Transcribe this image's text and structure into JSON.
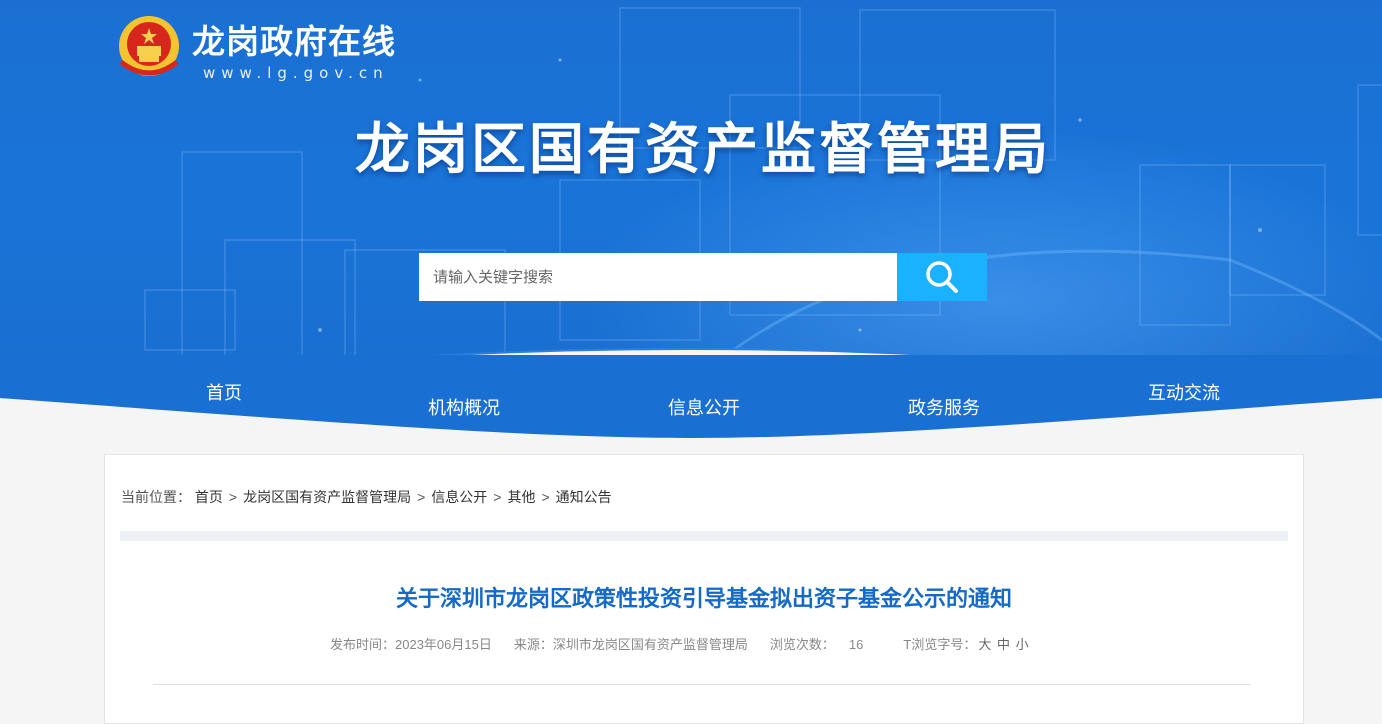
{
  "header": {
    "logo_title": "龙岗政府在线",
    "logo_url": "www.lg.gov.cn",
    "site_title": "龙岗区国有资产监督管理局",
    "search_placeholder": "请输入关键字搜索"
  },
  "nav": [
    "首页",
    "机构概况",
    "信息公开",
    "政务服务",
    "互动交流"
  ],
  "breadcrumb": {
    "label": "当前位置：",
    "items": [
      "首页",
      "龙岗区国有资产监督管理局",
      "信息公开",
      "其他",
      "通知公告"
    ],
    "separator": ">"
  },
  "article": {
    "title": "关于深圳市龙岗区政策性投资引导基金拟出资子基金公示的通知",
    "publish_label": "发布时间：",
    "publish_date": "2023年06月15日",
    "source_label": "来源：",
    "source": "深圳市龙岗区国有资产监督管理局",
    "views_label": "浏览次数：",
    "views": "16",
    "fontsize_label": "T浏览字号：",
    "fontsize_options": [
      "大",
      "中",
      "小"
    ]
  },
  "colors": {
    "banner_blue": "#1a6fd3",
    "search_button": "#1ab1ff",
    "article_title": "#1569c7"
  }
}
